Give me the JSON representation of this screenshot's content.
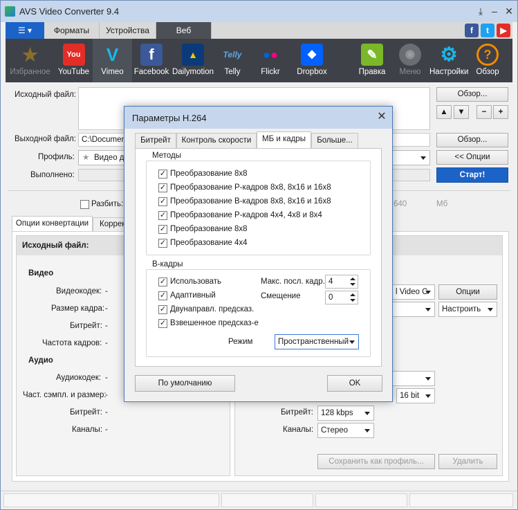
{
  "window": {
    "title": "AVS Video Converter 9.4"
  },
  "menu_tabs": {
    "menu_icon": "menu-icon",
    "formats": "Форматы",
    "devices": "Устройства",
    "web": "Веб"
  },
  "social": {
    "facebook": "f",
    "twitter": "t",
    "youtube": "▶"
  },
  "toolbar": [
    {
      "label": "Избранное",
      "icon": "star-icon"
    },
    {
      "label": "YouTube",
      "icon": "youtube-icon"
    },
    {
      "label": "Vimeo",
      "icon": "vimeo-icon"
    },
    {
      "label": "Facebook",
      "icon": "facebook-icon"
    },
    {
      "label": "Dailymotion",
      "icon": "dailymotion-icon"
    },
    {
      "label": "Telly",
      "icon": "telly-icon"
    },
    {
      "label": "Flickr",
      "icon": "flickr-icon"
    },
    {
      "label": "Dropbox",
      "icon": "dropbox-icon"
    },
    {
      "label": "Правка",
      "icon": "edit-icon"
    },
    {
      "label": "Меню",
      "icon": "disc-icon"
    },
    {
      "label": "Настройки",
      "icon": "gear-icon"
    },
    {
      "label": "Обзор",
      "icon": "help-icon"
    }
  ],
  "main": {
    "source_label": "Исходный файл:",
    "output_label": "Выходной файл:",
    "output_value": "C:\\Documents",
    "profile_label": "Профиль:",
    "profile_value": "Видео д",
    "done_label": "Выполнено:",
    "browse1": "Обзор...",
    "browse2": "Обзор...",
    "options_btn": "<< Опции",
    "start_btn": "Старт!",
    "split_label": "Разбить:",
    "size_value": "640",
    "size_unit": "Мб"
  },
  "conv_tabs": {
    "options": "Опции конвертации",
    "corr": "Коррек"
  },
  "left_panel": {
    "header": "Исходный файл:",
    "video": "Видео",
    "codec": "Видеокодек:",
    "frame": "Размер кадра:",
    "bitrate": "Битрейт:",
    "fps": "Частота кадров:",
    "audio": "Аудио",
    "acodec": "Аудиокодек:",
    "sample": "Част. сэмпл. и размер:",
    "abitrate": "Битрейт:",
    "channels": "Каналы:",
    "dash": "-"
  },
  "right_panel": {
    "codec_value": "l Video C",
    "options_btn": "Опции",
    "adjust": "Настроить",
    "bits": "16 bit",
    "bitrate_label": "Битрейт:",
    "bitrate_value": "128 kbps",
    "channels_label": "Каналы:",
    "channels_value": "Стерео",
    "save_profile": "Сохранить как профиль...",
    "delete": "Удалить"
  },
  "dialog": {
    "title": "Параметры H.264",
    "tabs": [
      "Битрейт",
      "Контроль скорости",
      "МБ и кадры",
      "Больше..."
    ],
    "methods_title": "Методы",
    "methods": [
      "Преобразование 8х8",
      "Преобразование Р-кадров 8х8, 8х16 и 16х8",
      "Преобразование В-кадров 8х8, 8х16 и 16х8",
      "Преобразование Р-кадров 4х4, 4х8 и 8х4",
      "Преобразование 8х8",
      "Преобразование 4х4"
    ],
    "bframes_title": "В-кадры",
    "bframes": [
      "Использовать",
      "Адаптивный",
      "Двунаправл. предсказ.",
      "Взвешенное предсказ-е"
    ],
    "max_label": "Макс. посл. кадр.",
    "max_value": "4",
    "offset_label": "Смещение",
    "offset_value": "0",
    "mode_label": "Режим",
    "mode_value": "Пространственный",
    "default_btn": "По умолчанию",
    "ok_btn": "OK"
  }
}
